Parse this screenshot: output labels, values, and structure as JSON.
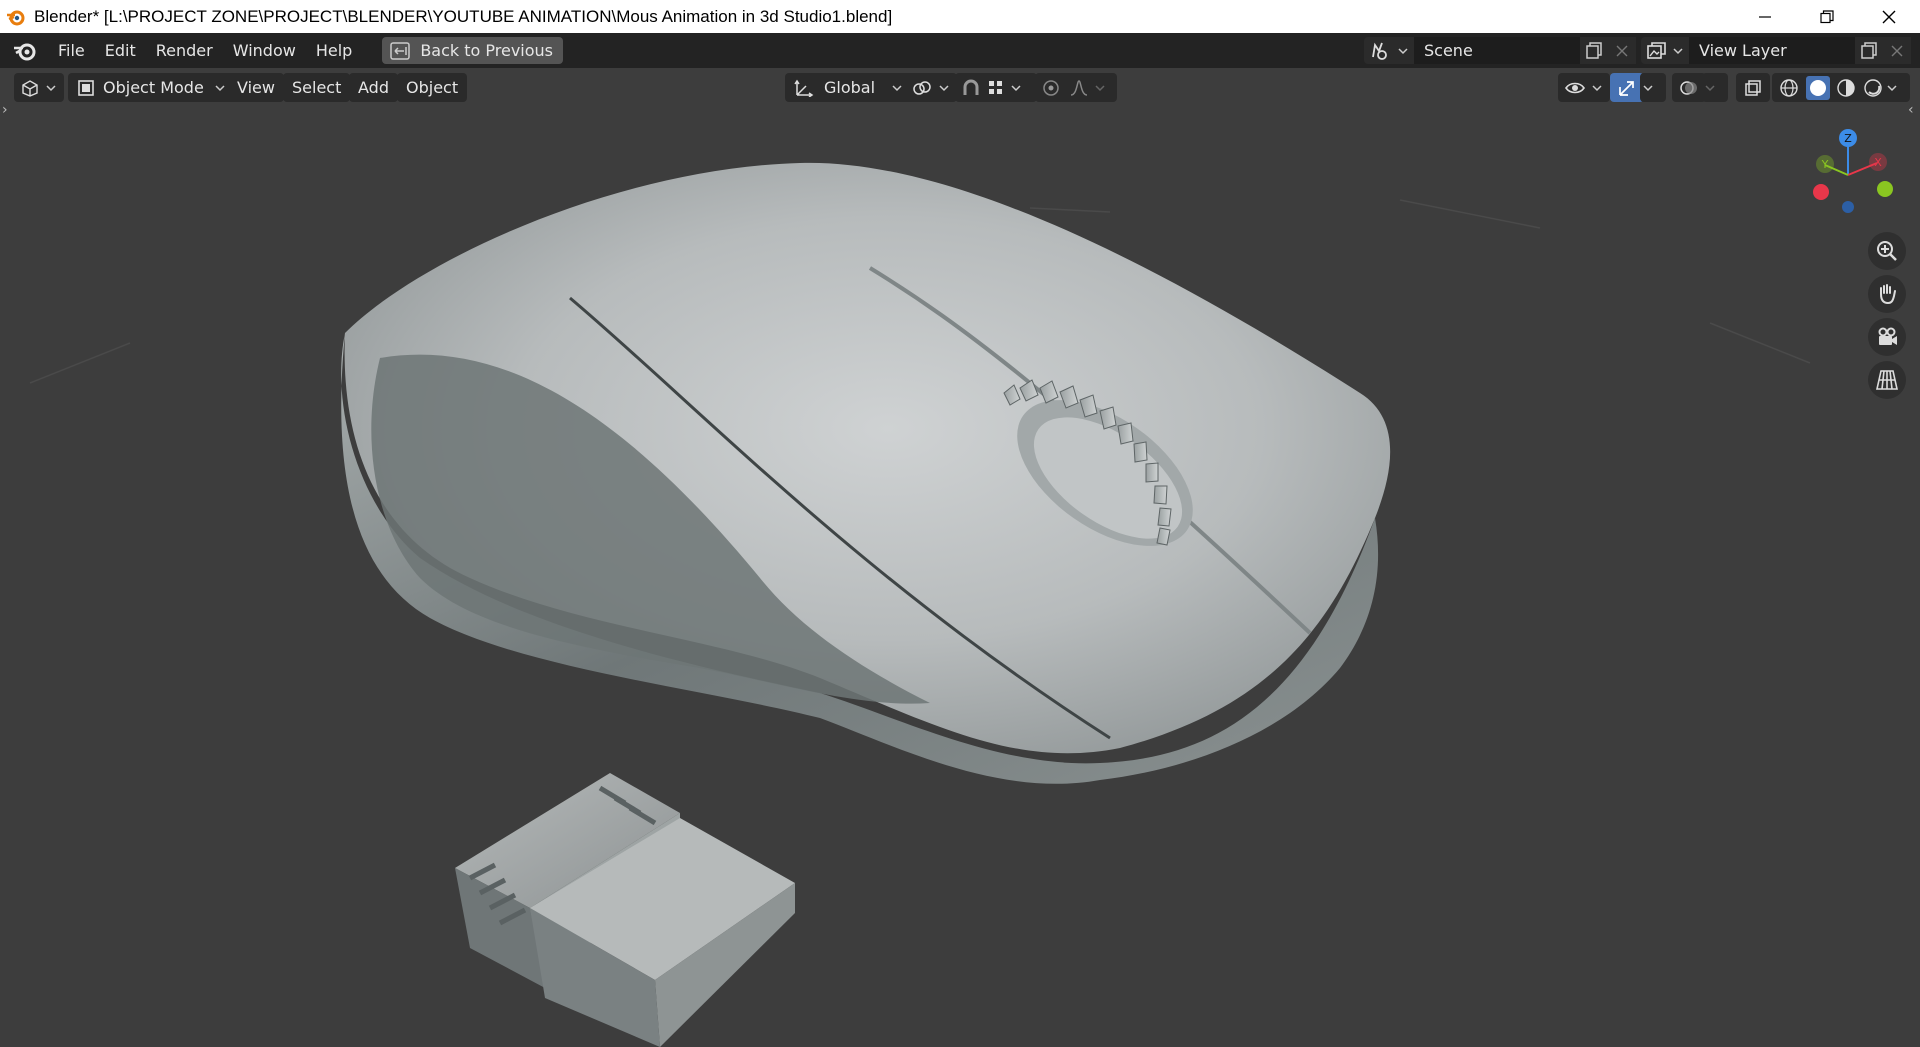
{
  "window": {
    "title": "Blender* [L:\\PROJECT ZONE\\PROJECT\\BLENDER\\YOUTUBE ANIMATION\\Mous Animation in 3d Studio1.blend]",
    "controls": [
      "minimize-icon",
      "restore-icon",
      "close-icon"
    ]
  },
  "menubar": {
    "items": [
      "File",
      "Edit",
      "Render",
      "Window",
      "Help"
    ],
    "back_label": "Back to Previous",
    "scene_name": "Scene",
    "view_layer": "View Layer"
  },
  "viewport_header": {
    "mode": "Object Mode",
    "menus": [
      "View",
      "Select",
      "Add",
      "Object"
    ],
    "orientation": "Global"
  },
  "colors": {
    "accent": "#4772b3",
    "axis_x": "#e8374a",
    "axis_y": "#8ac621",
    "axis_z": "#3c8ce8",
    "background": "#3d3d3d"
  }
}
